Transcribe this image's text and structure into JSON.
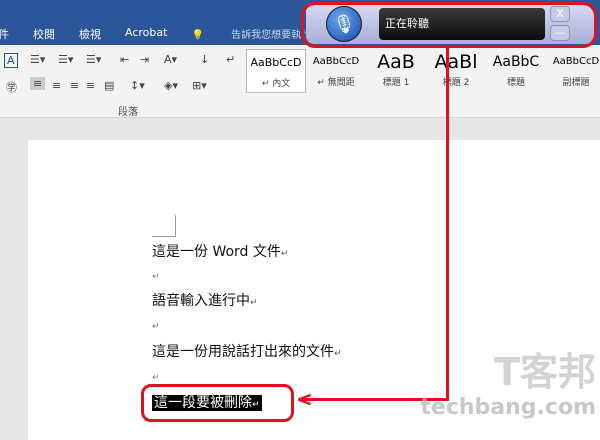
{
  "ribbon_tabs": [
    "件",
    "校閱",
    "檢視",
    "Acrobat"
  ],
  "tell_me": "告訴我您想要執行的動作...",
  "paragraph_group": "段落",
  "styles": [
    {
      "preview": "AaBbCcD",
      "label": "↵ 內文"
    },
    {
      "preview": "AaBbCcD",
      "label": "↵ 無間距"
    },
    {
      "preview": "AaB",
      "label": "標題 1"
    },
    {
      "preview": "AaBl",
      "label": "標題 2"
    },
    {
      "preview": "AaBbC",
      "label": "標題"
    },
    {
      "preview": "AaBbCcD",
      "label": "副標題"
    }
  ],
  "speech": {
    "status": "正在聆聽",
    "close": "X",
    "minimize": "—"
  },
  "document": {
    "lines": [
      "這是一份 Word 文件",
      "語音輸入進行中",
      "這是一份用說話打出來的文件",
      "這一段要被刪除"
    ],
    "para_mark": "↵"
  },
  "watermark": {
    "logo": "T客邦",
    "site": "techbang.com"
  },
  "colors": {
    "accent": "#2b579a",
    "highlight": "#e0101e"
  }
}
